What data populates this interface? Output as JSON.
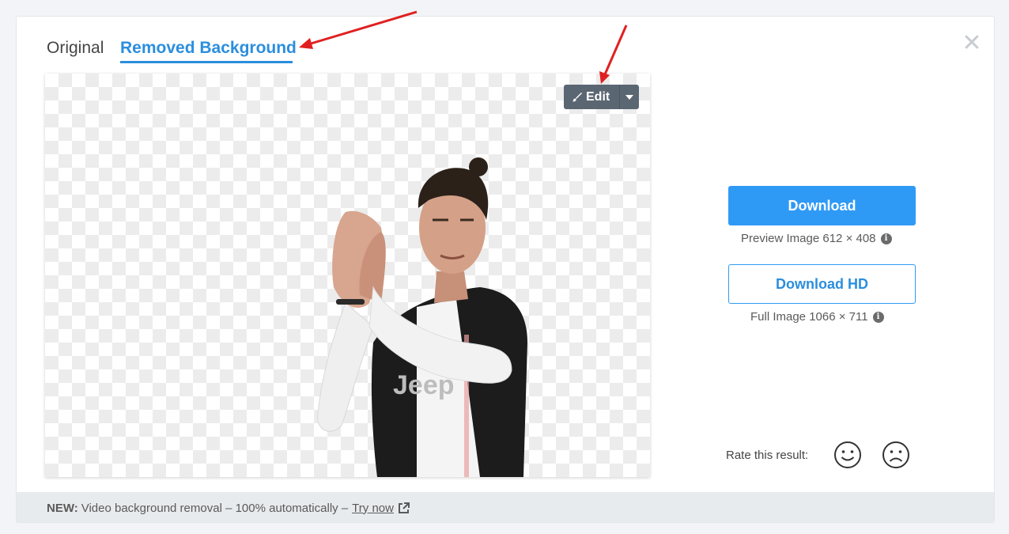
{
  "tabs": {
    "original": "Original",
    "removed": "Removed Background"
  },
  "close_symbol": "✕",
  "edit": {
    "label": "Edit",
    "icon": "brush-icon",
    "dropdown_icon": "caret-down-icon"
  },
  "download": {
    "label": "Download",
    "caption": "Preview Image 612 × 408"
  },
  "download_hd": {
    "label": "Download HD",
    "caption": "Full Image 1066 × 711"
  },
  "info_symbol": "i",
  "rating": {
    "label": "Rate this result:",
    "positive_icon": "smile-icon",
    "negative_icon": "frown-icon"
  },
  "footer": {
    "prefix": "NEW:",
    "text": "Video background removal – 100% automatically –",
    "link": "Try now",
    "link_icon": "external-link-icon"
  },
  "colors": {
    "accent": "#2f9af6",
    "tab_active": "#2b8ede",
    "edit_button": "#5b6673",
    "annotation_arrow": "#e02020"
  }
}
